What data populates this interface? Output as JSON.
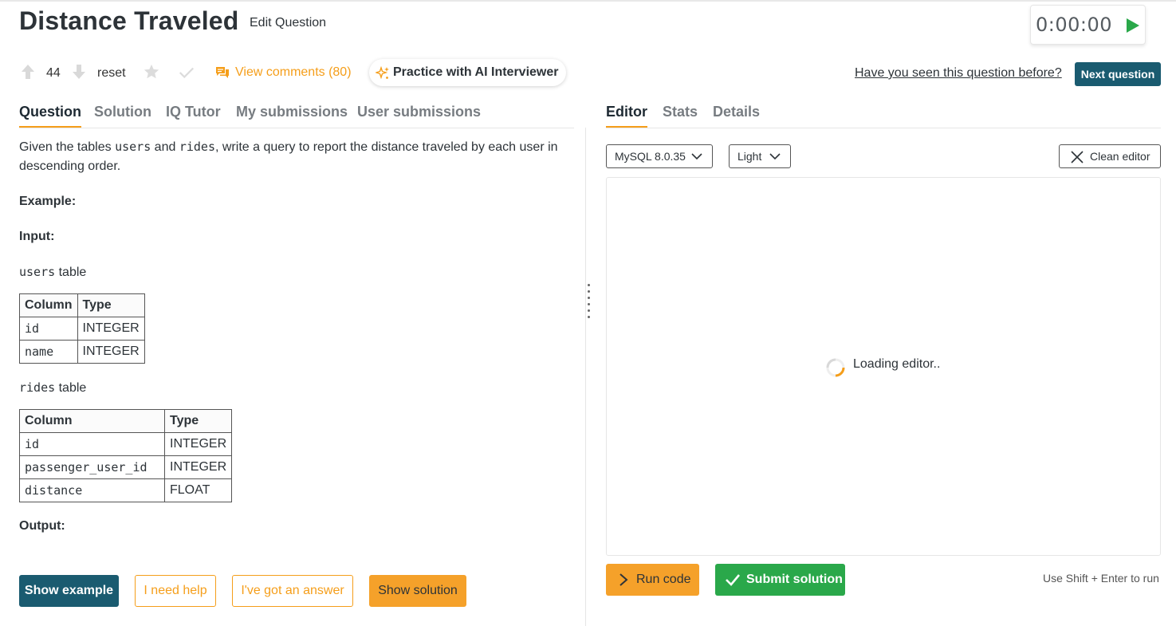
{
  "header": {
    "title": "Distance Traveled",
    "edit_label": "Edit Question",
    "timer": "0:00:00"
  },
  "actions": {
    "votes": "44",
    "reset_label": "reset",
    "comments_label": "View comments (80)",
    "ai_label": "Practice with AI Interviewer",
    "seen_label": "Have you seen this question before?",
    "next_label": "Next question"
  },
  "left_tabs": [
    "Question",
    "Solution",
    "IQ Tutor",
    "My submissions",
    "User submissions"
  ],
  "right_tabs": [
    "Editor",
    "Stats",
    "Details"
  ],
  "question": {
    "intro_1": "Given the tables ",
    "table1_name": "users",
    "intro_2": " and ",
    "table2_name": "rides",
    "intro_3": ", write a query to report the distance traveled by each user in descending order.",
    "example_label": "Example:",
    "input_label": "Input:",
    "table_suffix": " table",
    "users_table": {
      "headers": [
        "Column",
        "Type"
      ],
      "rows": [
        [
          "id",
          "INTEGER"
        ],
        [
          "name",
          "INTEGER"
        ]
      ]
    },
    "rides_table": {
      "headers": [
        "Column",
        "Type"
      ],
      "rows": [
        [
          "id",
          "INTEGER"
        ],
        [
          "passenger_user_id",
          "INTEGER"
        ],
        [
          "distance",
          "FLOAT"
        ]
      ]
    },
    "output_label": "Output:"
  },
  "left_buttons": {
    "show_example": "Show example",
    "need_help": "I need help",
    "got_answer": "I've got an answer",
    "show_solution": "Show solution"
  },
  "editor": {
    "language": "MySQL 8.0.35",
    "theme": "Light",
    "clean_label": "Clean editor",
    "loading_text": "Loading editor..",
    "run_label": "Run code",
    "submit_label": "Submit solution",
    "hint": "Use Shift + Enter to run"
  },
  "colors": {
    "accent_orange": "#f59e1a",
    "primary_teal": "#1a5b70",
    "success_green": "#2aa84a"
  }
}
